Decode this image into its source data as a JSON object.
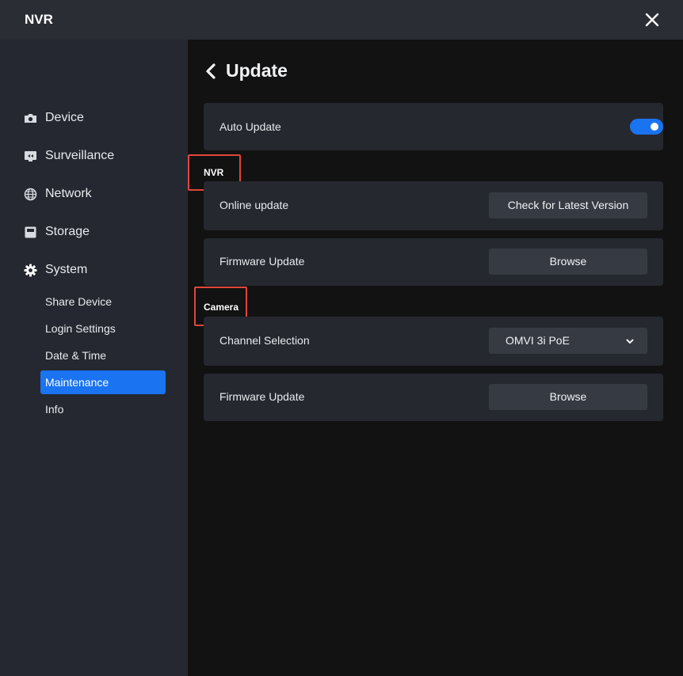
{
  "window": {
    "title": "NVR"
  },
  "sidebar": {
    "items": [
      {
        "label": "Device",
        "icon": "camera-icon"
      },
      {
        "label": "Surveillance",
        "icon": "monitor-icon"
      },
      {
        "label": "Network",
        "icon": "globe-icon"
      },
      {
        "label": "Storage",
        "icon": "storage-icon"
      },
      {
        "label": "System",
        "icon": "gear-icon"
      }
    ],
    "sub_items": [
      {
        "label": "Share Device"
      },
      {
        "label": "Login Settings"
      },
      {
        "label": "Date & Time"
      },
      {
        "label": "Maintenance",
        "active": true
      },
      {
        "label": "Info"
      }
    ]
  },
  "page": {
    "title": "Update",
    "auto_update": {
      "label": "Auto Update",
      "enabled": true
    },
    "nvr_section": {
      "heading": "NVR",
      "online_update": {
        "label": "Online update",
        "button": "Check for Latest Version"
      },
      "firmware_update": {
        "label": "Firmware Update",
        "button": "Browse"
      }
    },
    "camera_section": {
      "heading": "Camera",
      "channel_selection": {
        "label": "Channel Selection",
        "selected": "OMVI 3i PoE"
      },
      "firmware_update": {
        "label": "Firmware Update",
        "button": "Browse"
      }
    }
  },
  "colors": {
    "accent": "#1a73f0",
    "highlight": "#e0473a",
    "sidebar_bg": "#252830",
    "content_bg": "#121213",
    "card_bg": "#25282f"
  }
}
